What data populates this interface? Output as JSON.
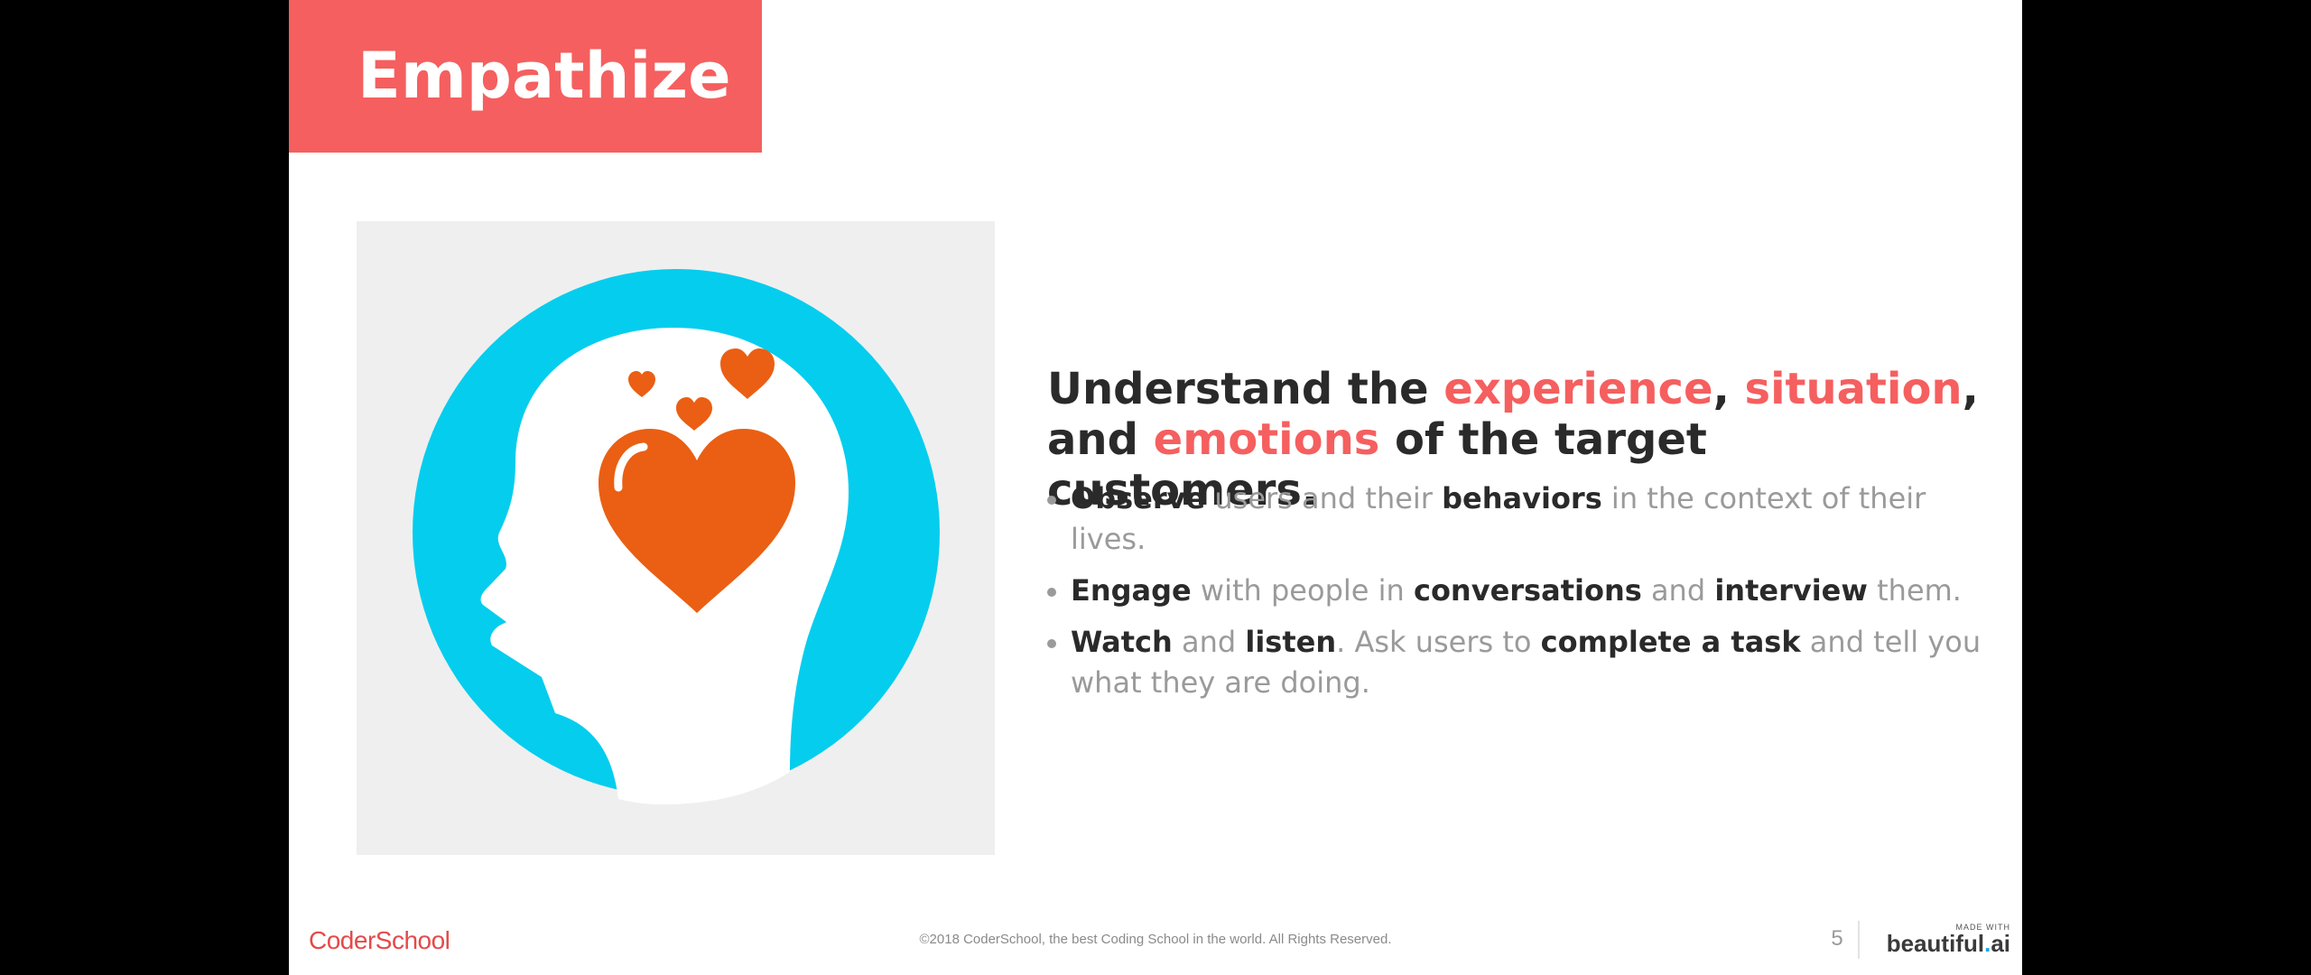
{
  "slide": {
    "title": "Empathize",
    "headline": {
      "part1": "Understand the ",
      "accent1": "experience",
      "part2": ", ",
      "accent2": "situation",
      "part3": ", and ",
      "accent3": "emotions",
      "part4": " of the target customers."
    },
    "bullets": [
      {
        "b1": "Observe",
        "t1": " users and their ",
        "b2": "behaviors",
        "t2": " in the context of their lives."
      },
      {
        "b1": "Engage",
        "t1": " with people in ",
        "b2": "conversations",
        "t2": " and ",
        "b3": "interview",
        "t3": " them."
      },
      {
        "b1": "Watch",
        "t1": " and ",
        "b2": "listen",
        "t2": ". Ask users to ",
        "b3": "complete a task",
        "t3": " and tell you what they are doing."
      }
    ],
    "image": {
      "icon": "head-with-hearts-icon"
    }
  },
  "footer": {
    "logo": "CoderSchool",
    "copyright": "©2018 CoderSchool, the best Coding School in the world. All Rights Reserved.",
    "page_number": "5",
    "made_with": "MADE WITH",
    "brand_name": "beautiful",
    "brand_dot": ".",
    "brand_suffix": "ai"
  },
  "colors": {
    "accent": "#f55f5f",
    "circle": "#05cdee",
    "heart": "#ea5f13",
    "panel": "#efefef"
  }
}
